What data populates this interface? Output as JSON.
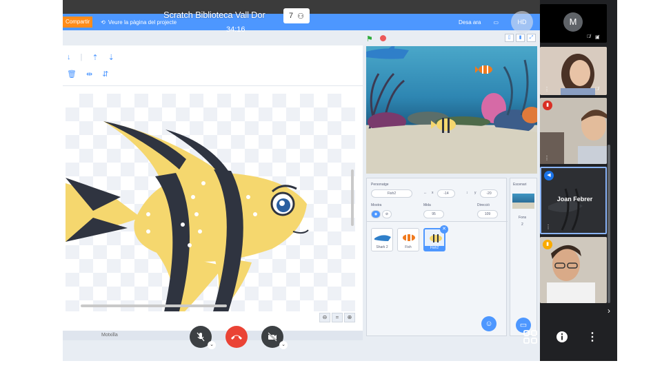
{
  "call": {
    "title": "Scratch Biblioteca Vall Dor",
    "participant_count": "7",
    "timer": "34:16",
    "quality": "HD"
  },
  "scratch": {
    "share_label": "Compartir",
    "see_project_label": "Veure la pàgina del projecte",
    "done_label": "Desa ara",
    "bottom_label": "Motxilla",
    "sprite_info": {
      "sprite_label": "Personatge",
      "sprite_name": "Fish2",
      "x_label": "x",
      "x_value": "-14",
      "y_label": "y",
      "y_value": "-20",
      "show_label": "Mostra",
      "size_label": "Mida",
      "size_value": "95",
      "direction_label": "Direcció",
      "direction_value": "109"
    },
    "sprites": [
      {
        "name": "Shark 2"
      },
      {
        "name": "Fish"
      },
      {
        "name": "Fish2"
      }
    ],
    "stage_pane": {
      "title": "Escenari",
      "backdrops_label": "Fons",
      "backdrops_count": "2"
    }
  },
  "participants": [
    {
      "initial": "M"
    },
    {
      "name": ""
    },
    {
      "name": ""
    },
    {
      "name": "Joan Febrer"
    },
    {
      "name": ""
    }
  ],
  "colors": {
    "scratch_blue": "#4d97ff",
    "end_call_red": "#ea4335",
    "share_orange": "#ff8c1a",
    "fish_yellow": "#f5d76e",
    "fish_stripe": "#2f3440"
  }
}
